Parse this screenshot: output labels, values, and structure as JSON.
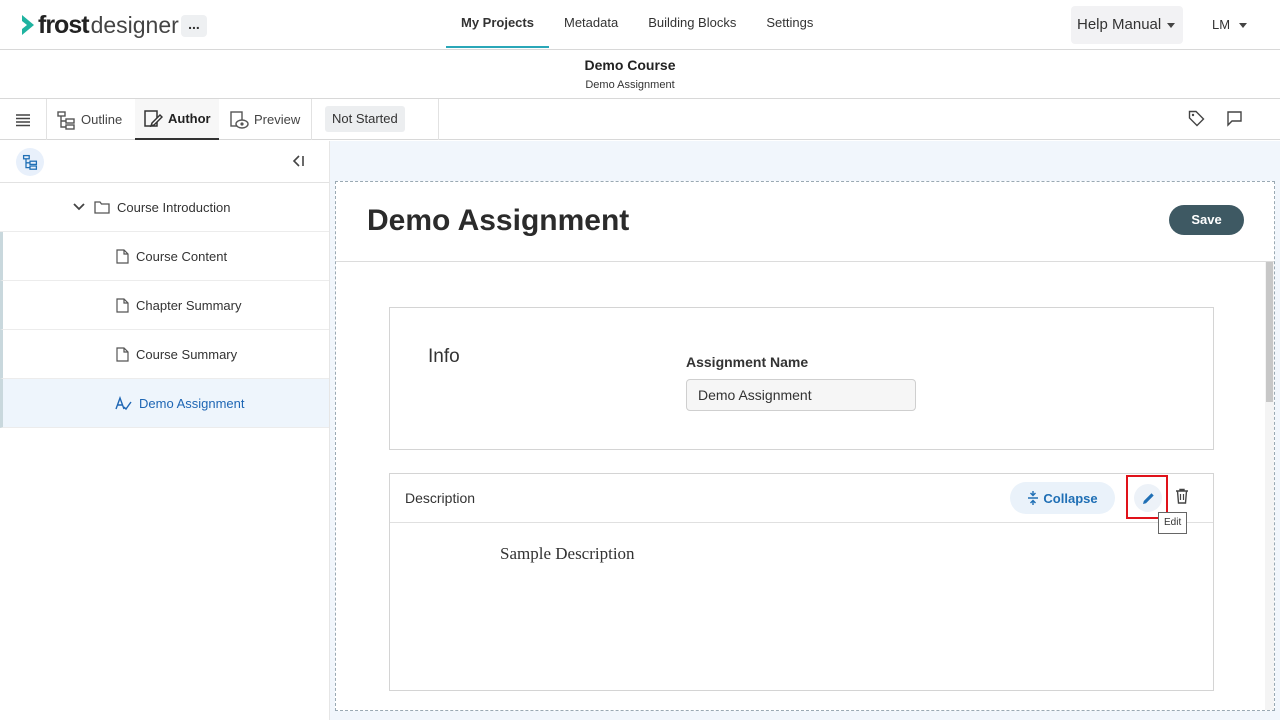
{
  "brand": {
    "name_bold": "frost",
    "name_light": "designer",
    "more_label": "...",
    "accent_color": "#1fb3a0"
  },
  "nav": {
    "tabs": [
      "My Projects",
      "Metadata",
      "Building Blocks",
      "Settings"
    ],
    "active": "My Projects"
  },
  "help": {
    "label": "Help Manual"
  },
  "user": {
    "initials": "LM"
  },
  "course": {
    "title": "Demo Course",
    "subtitle": "Demo Assignment"
  },
  "toolbar": {
    "outline_label": "Outline",
    "author_label": "Author",
    "preview_label": "Preview",
    "status_label": "Not Started",
    "right_icons": [
      "tag-icon",
      "comment-icon"
    ]
  },
  "sidebar": {
    "folder": {
      "label": "Course Introduction",
      "icon": "folder-icon",
      "expanded": true
    },
    "items": [
      {
        "label": "Course Content",
        "icon": "file-icon"
      },
      {
        "label": "Chapter Summary",
        "icon": "file-icon"
      },
      {
        "label": "Course Summary",
        "icon": "file-icon"
      },
      {
        "label": "Demo Assignment",
        "icon": "assignment-icon",
        "selected": true
      }
    ]
  },
  "main": {
    "title": "Demo Assignment",
    "save_label": "Save",
    "info": {
      "section_label": "Info",
      "field_label": "Assignment Name",
      "field_value": "Demo Assignment"
    },
    "description": {
      "section_label": "Description",
      "collapse_label": "Collapse",
      "edit_tooltip": "Edit",
      "body": "Sample Description"
    }
  }
}
